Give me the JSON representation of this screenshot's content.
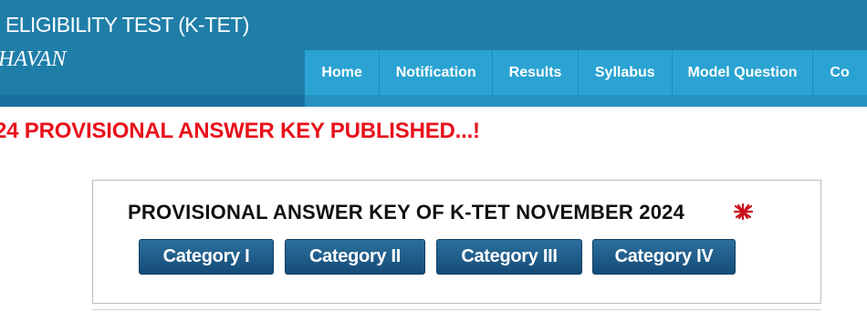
{
  "header": {
    "title": "ELIGIBILITY TEST (K-TET)",
    "subtitle": "HAVAN"
  },
  "nav": {
    "items": [
      {
        "label": "Home"
      },
      {
        "label": "Notification"
      },
      {
        "label": "Results"
      },
      {
        "label": "Syllabus"
      },
      {
        "label": "Model Question"
      },
      {
        "label": "Co"
      }
    ]
  },
  "announcement": "24 PROVISIONAL ANSWER KEY PUBLISHED...!",
  "panel": {
    "title": "PROVISIONAL ANSWER KEY OF K-TET NOVEMBER 2024",
    "new_icon": "new-badge-icon",
    "buttons": [
      {
        "label": "Category I"
      },
      {
        "label": "Category II"
      },
      {
        "label": "Category III"
      },
      {
        "label": "Category IV"
      }
    ]
  },
  "colors": {
    "header_bg": "#1f7ea8",
    "nav_bg": "#2aa3d3",
    "announcement": "#e8111b",
    "button": "#1f5c8a"
  }
}
